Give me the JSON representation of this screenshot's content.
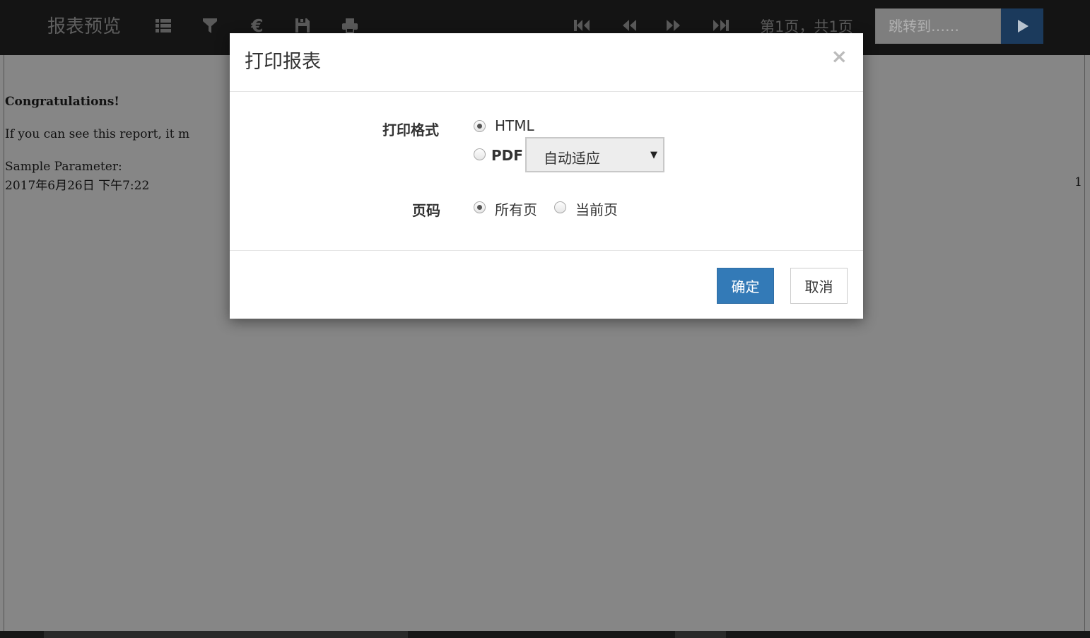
{
  "toolbar": {
    "title": "报表预览",
    "icons": [
      "list-icon",
      "filter-icon",
      "euro-icon",
      "save-icon",
      "print-icon",
      "first-page-icon",
      "prev-page-icon",
      "next-page-icon",
      "last-page-icon"
    ],
    "page_info": "第1页，共1页",
    "jump_placeholder": "跳转到……"
  },
  "report": {
    "congrats": "Congratulations!",
    "line2": "If you can see this report, it m",
    "param_label": "Sample Parameter:",
    "param_value": "2017年6月26日 下午7:22",
    "page_number": "1"
  },
  "modal": {
    "title": "打印报表",
    "close": "×",
    "format_label": "打印格式",
    "format_options": [
      {
        "label": "HTML",
        "checked": true
      },
      {
        "label": "PDF",
        "checked": false
      }
    ],
    "pdf_select_value": "自动适应",
    "pages_label": "页码",
    "pages_options": [
      {
        "label": "所有页",
        "checked": true
      },
      {
        "label": "当前页",
        "checked": false
      }
    ],
    "ok_label": "确定",
    "cancel_label": "取消"
  },
  "colors": {
    "overlay_bg": "#868686",
    "toolbar_bg": "#141414",
    "primary": "#337ab7"
  }
}
